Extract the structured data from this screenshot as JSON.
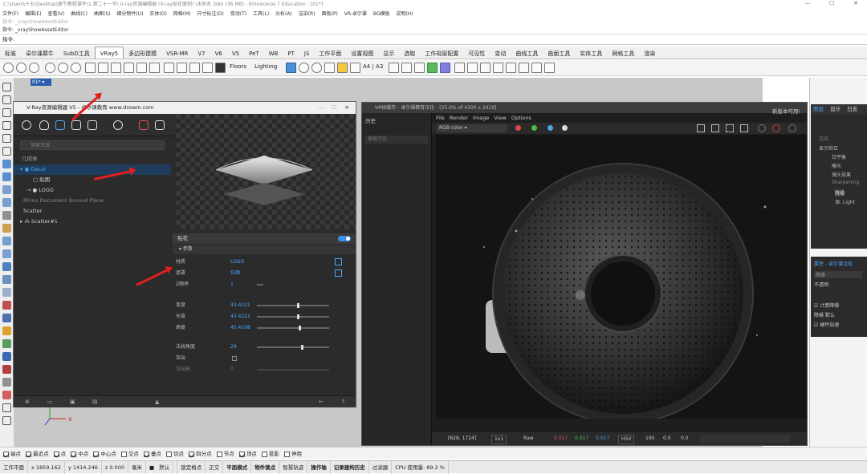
{
  "window": {
    "title": "C:\\Users\\十五\\Desktop\\犀牛教程课件\\1.第二十一节\\ V-ray资源编辑器  (V-ray贴花案例) \\未命名.3dm (36 MB) - Rhinoceros 7 Education - [01*]"
  },
  "menubar": [
    "文件(F)",
    "编辑(E)",
    "查看(V)",
    "曲线(C)",
    "曲面(S)",
    "细分物件(U)",
    "实体(O)",
    "网格(M)",
    "尺寸标注(D)",
    "变动(T)",
    "工具(L)",
    "分析(A)",
    "渲染(R)",
    "面板(P)",
    "VR-卓尔课",
    "BG模板",
    "说明(H)"
  ],
  "command": {
    "history": "指令: _vrayShowAssetEditor",
    "history2": "指令: _vrayShowAssetEditor",
    "prompt": "指令:"
  },
  "tabs": [
    "标准",
    "卓尔课犀牛",
    "SubD工具",
    "VRay5",
    "多边形建模",
    "VSR-MR",
    "V7",
    "V6",
    "V5",
    "PeT",
    "WB",
    "PT",
    "JS",
    "工作平面",
    "设置视图",
    "显示",
    "选取",
    "工作视窗配置",
    "可见性",
    "变动",
    "曲线工具",
    "曲面工具",
    "实体工具",
    "网格工具",
    "渲染"
  ],
  "active_tab": "VRay5",
  "toolbar": {
    "floors": "Floors",
    "lighting": "Lighting",
    "a4": "A4 | A3"
  },
  "viewport": {
    "label": "01*"
  },
  "asset_editor": {
    "title": "V-Ray资源编辑器 V5 - 卓尔课教育 www.drowm.com",
    "search_placeholder": "搜索资源",
    "section": "几何体",
    "tree": [
      "Decal",
      "贴图",
      "LOGO",
      "Rhino Document Ground Plane",
      "Scatter",
      "Scatter#1"
    ],
    "params": {
      "header": "贴花",
      "subheader": "参数",
      "rows": [
        {
          "label": "材质",
          "value": "LOGO"
        },
        {
          "label": "遮罩",
          "value": "位图"
        },
        {
          "label": "Z顺序",
          "value": "1"
        },
        {
          "label": "宽度",
          "value": "43.4221"
        },
        {
          "label": "长度",
          "value": "43.4221"
        },
        {
          "label": "高度",
          "value": "45.4108"
        },
        {
          "label": "法线角度",
          "value": "29"
        },
        {
          "label": "突出",
          "value": ""
        },
        {
          "label": "突出高",
          "value": "0"
        }
      ]
    }
  },
  "vfb": {
    "title": "VR帧缓存 - 卓尔课教育汉化 - [25.0% of 4300 x 2419]",
    "left_tab": "历史",
    "search": "搜索历史",
    "menu": [
      "File",
      "Render",
      "Image",
      "View",
      "Options"
    ],
    "channel": "RGB color",
    "update_notice": "新版本可用!",
    "status": {
      "coords": "[628, 1724]",
      "mode": "1x1",
      "raw": "Raw",
      "r": "0.017",
      "g": "0.017",
      "b": "0.017",
      "colorspace": "HSV",
      "h": "195",
      "s": "0.0",
      "v": "0.0"
    }
  },
  "right_panel": {
    "tabs": [
      "图层",
      "设计",
      "日志"
    ],
    "layers": [
      "渲染",
      "显示检正",
      "白平衡",
      "曝光",
      "镜头效果",
      "Sharpening",
      "降噪",
      "源: Light"
    ],
    "props_title": "属性 - 卓尔课汉化",
    "prop_rows": [
      "降噪",
      "不透明",
      "计算降噪",
      "降噪 默认",
      "硬件加速"
    ]
  },
  "osnap": [
    {
      "label": "端点",
      "on": true
    },
    {
      "label": "最近点",
      "on": true
    },
    {
      "label": "点",
      "on": true
    },
    {
      "label": "中点",
      "on": true
    },
    {
      "label": "中心点",
      "on": true
    },
    {
      "label": "交点",
      "on": false
    },
    {
      "label": "垂点",
      "on": true
    },
    {
      "label": "切点",
      "on": false
    },
    {
      "label": "四分点",
      "on": true
    },
    {
      "label": "节点",
      "on": false
    },
    {
      "label": "顶点",
      "on": true
    },
    {
      "label": "投影",
      "on": false
    },
    {
      "label": "停用",
      "on": false
    }
  ],
  "status": {
    "plane": "工作平面",
    "x": "x 1859.162",
    "y": "y 1414.246",
    "z": "z 0.000",
    "units": "毫米",
    "layer": "默认",
    "items": [
      "锁定格点",
      "正交",
      "平面模式",
      "物件锁点",
      "智慧轨迹",
      "操作轴",
      "记录建构历史",
      "过滤器"
    ],
    "cpu": "CPU 使用量: 89.2 %"
  }
}
